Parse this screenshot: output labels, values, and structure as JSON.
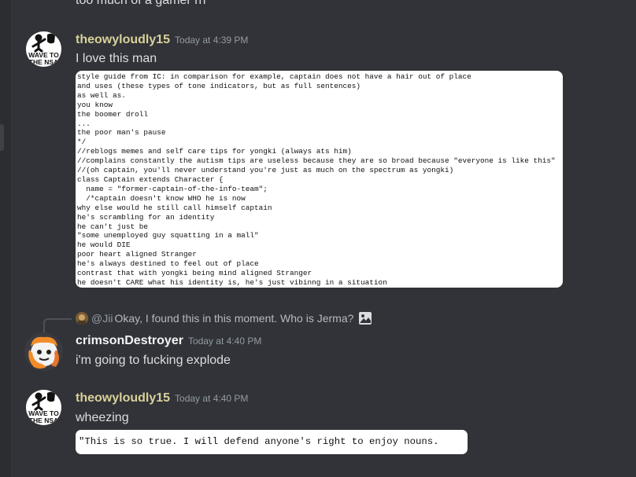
{
  "previous_message": {
    "text": "too much of a gamer rn"
  },
  "messages": [
    {
      "username": "theowyloudly15",
      "timestamp": "Today at 4:39 PM",
      "content": "I love this man",
      "avatar_text": [
        "WAVE TO",
        "THE NSA"
      ],
      "attachment": {
        "lines": [
          "style guide from IC: in comparison for example, captain does not have a hair out of place",
          "and uses (these types of tone indicators, but as full sentences)",
          "as well as.",
          "you know",
          "the boomer droll",
          "...",
          "the poor man's pause",
          "*/",
          "//reblogs memes and self care tips for yongki (always ats him)",
          "//complains constantly the autism tips are useless because they are so broad because \"everyone is like this\"",
          "//(oh captain, you'll never understand you're just as much on the spectrum as yongki)",
          "class Captain extends Character {",
          "  name = \"former-captain-of-the-info-team\";",
          "  /*captain doesn't know WHO he is now",
          "why else would he still call himself captain",
          "he's scrambling for an identity",
          "he can't just be",
          "\"some unemployed guy squatting in a mall\"",
          "he would DIE",
          "poor heart aligned Stranger",
          "he's always destined to feel out of place",
          "contrast that with yongki being mind aligned Stranger",
          "he doesn't CARE what his identity is, he's just vibinng in a situation"
        ]
      }
    },
    {
      "reply": {
        "mention": "@Jii",
        "text": "Okay, I found this in this moment. Who is Jerma?"
      },
      "username": "crimsonDestroyer",
      "timestamp": "Today at 4:40 PM",
      "content": "i'm going to fucking explode"
    },
    {
      "username": "theowyloudly15",
      "timestamp": "Today at 4:40 PM",
      "content": "wheezing",
      "avatar_text": [
        "WAVE TO",
        "THE NSA"
      ],
      "quote_card": "\"This is so true. I will defend anyone's right to enjoy nouns."
    }
  ],
  "colors": {
    "background": "#313338",
    "username_yellow": "#d8d19a",
    "username_white": "#f2f3f5",
    "timestamp": "#949ba4",
    "text": "#dbdee1"
  }
}
